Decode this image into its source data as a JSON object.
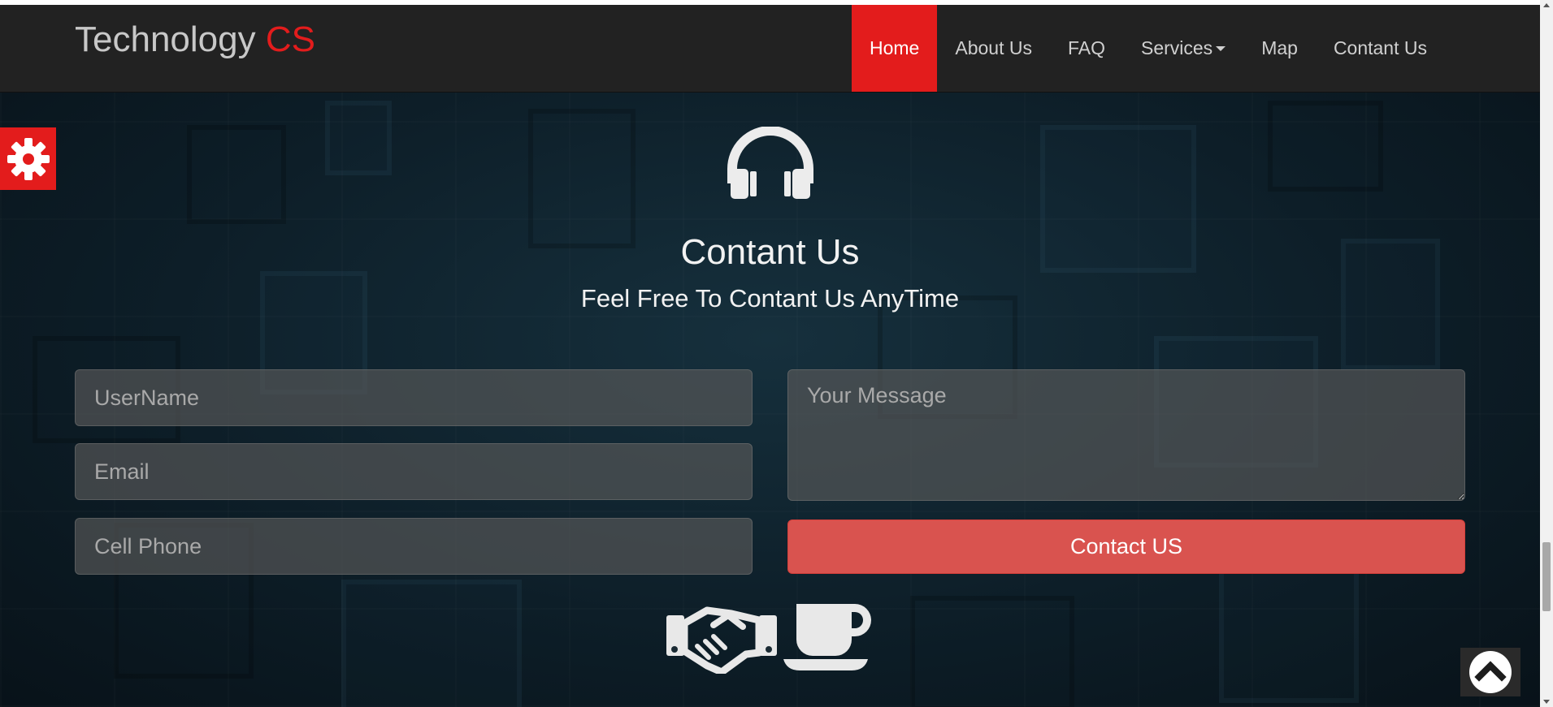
{
  "brand": {
    "name": "Technology",
    "accent": "CS"
  },
  "nav": {
    "items": [
      {
        "label": "Home",
        "active": true
      },
      {
        "label": "About Us"
      },
      {
        "label": "FAQ"
      },
      {
        "label": "Services"
      },
      {
        "label": "Map"
      },
      {
        "label": "Contant Us"
      }
    ]
  },
  "contact": {
    "title": "Contant Us",
    "subtitle": "Feel Free To Contant Us AnyTime",
    "username_placeholder": "UserName",
    "email_placeholder": "Email",
    "phone_placeholder": "Cell Phone",
    "message_placeholder": "Your Message",
    "submit_label": "Contact US"
  },
  "icons": {
    "settings": "gear-icon",
    "headset": "headphones-icon",
    "handshake": "handshake-icon",
    "coffee": "coffee-cup-icon",
    "scroll_top": "chevron-up-icon"
  },
  "colors": {
    "accent": "#e31c1c",
    "navbar": "#222222",
    "button": "#d9534f"
  }
}
